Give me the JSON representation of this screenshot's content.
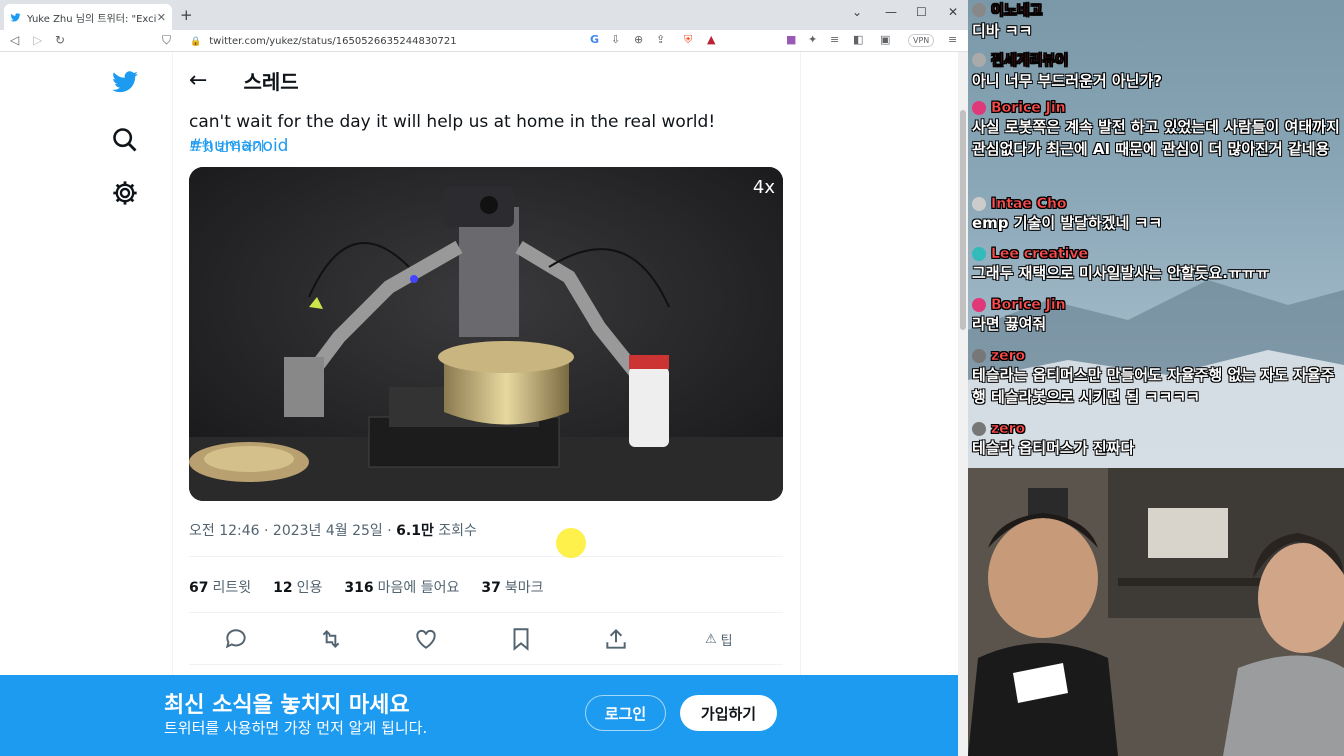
{
  "browser": {
    "tab_title": "Yuke Zhu 님의 트위터: \"Excited to",
    "url": "twitter.com/yukez/status/1650526635244830721",
    "vpn_label": "VPN"
  },
  "twitter": {
    "header_title": "스레드",
    "tweet_text_main": "can't wait for the day it will help us at home in the real world! ",
    "tweet_hashtag": "#humanoid",
    "translate": "트윗 번역하기",
    "speed_badge": "4x",
    "meta_time": "오전 12:46 · 2023년 4월 25일 · ",
    "meta_views_count": "6.1만",
    "meta_views_label": " 조회수",
    "stats": {
      "retweets_count": "67",
      "retweets_label": "리트윗",
      "quotes_count": "12",
      "quotes_label": "인용",
      "likes_count": "316",
      "likes_label": "마음에 들어요",
      "bookmarks_count": "37",
      "bookmarks_label": "북마크"
    },
    "tip_label": "팁"
  },
  "banner": {
    "headline": "최신 소식을 놓치지 마세요",
    "subline": "트위터를 사용하면 가장 먼저 알게 됩니다.",
    "login": "로그인",
    "signup": "가입하기"
  },
  "chat": {
    "messages": [
      {
        "user": "이노네고",
        "text": "디바 ㅋㅋ",
        "color": "#ff4b4b"
      },
      {
        "user": "전세계리뷰어",
        "text": "아니 너무 부드러운거 아닌가?",
        "color": "#ff4b4b"
      },
      {
        "user": "Borice Jin",
        "text": "사실 로봇쪽은 계속 발전 하고 있었는데 사람들이 여태까지 관심없다가 최근에 AI 때문에 관심이 더 많아진거 같네용",
        "color": "#ff4b4b"
      },
      {
        "user": "Intae Cho",
        "text": "emp 기술이 발달하겠네 ㅋㅋ",
        "color": "#ff4b4b"
      },
      {
        "user": "Lee creative",
        "text": "그래두 재택으로 미사일발사는 안할듯요.ㅠㅠㅠ",
        "color": "#ff4b4b"
      },
      {
        "user": "Borice Jin",
        "text": "라면 끓여줘",
        "color": "#ff4b4b"
      },
      {
        "user": "zero",
        "text": "테슬라는 옵티머스만 만들어도 자율주행 없는 자도 자율주행 테슬라봇으로 시키면 됨 ㅋㅋㅋㅋ",
        "color": "#ff4b4b"
      },
      {
        "user": "zero",
        "text": "테슬라 옵티머스가 진짜다",
        "color": "#ff4b4b"
      }
    ]
  },
  "colors": {
    "twitter_blue": "#1d9bf0",
    "text_dark": "#0f1419",
    "text_gray": "#536471"
  }
}
